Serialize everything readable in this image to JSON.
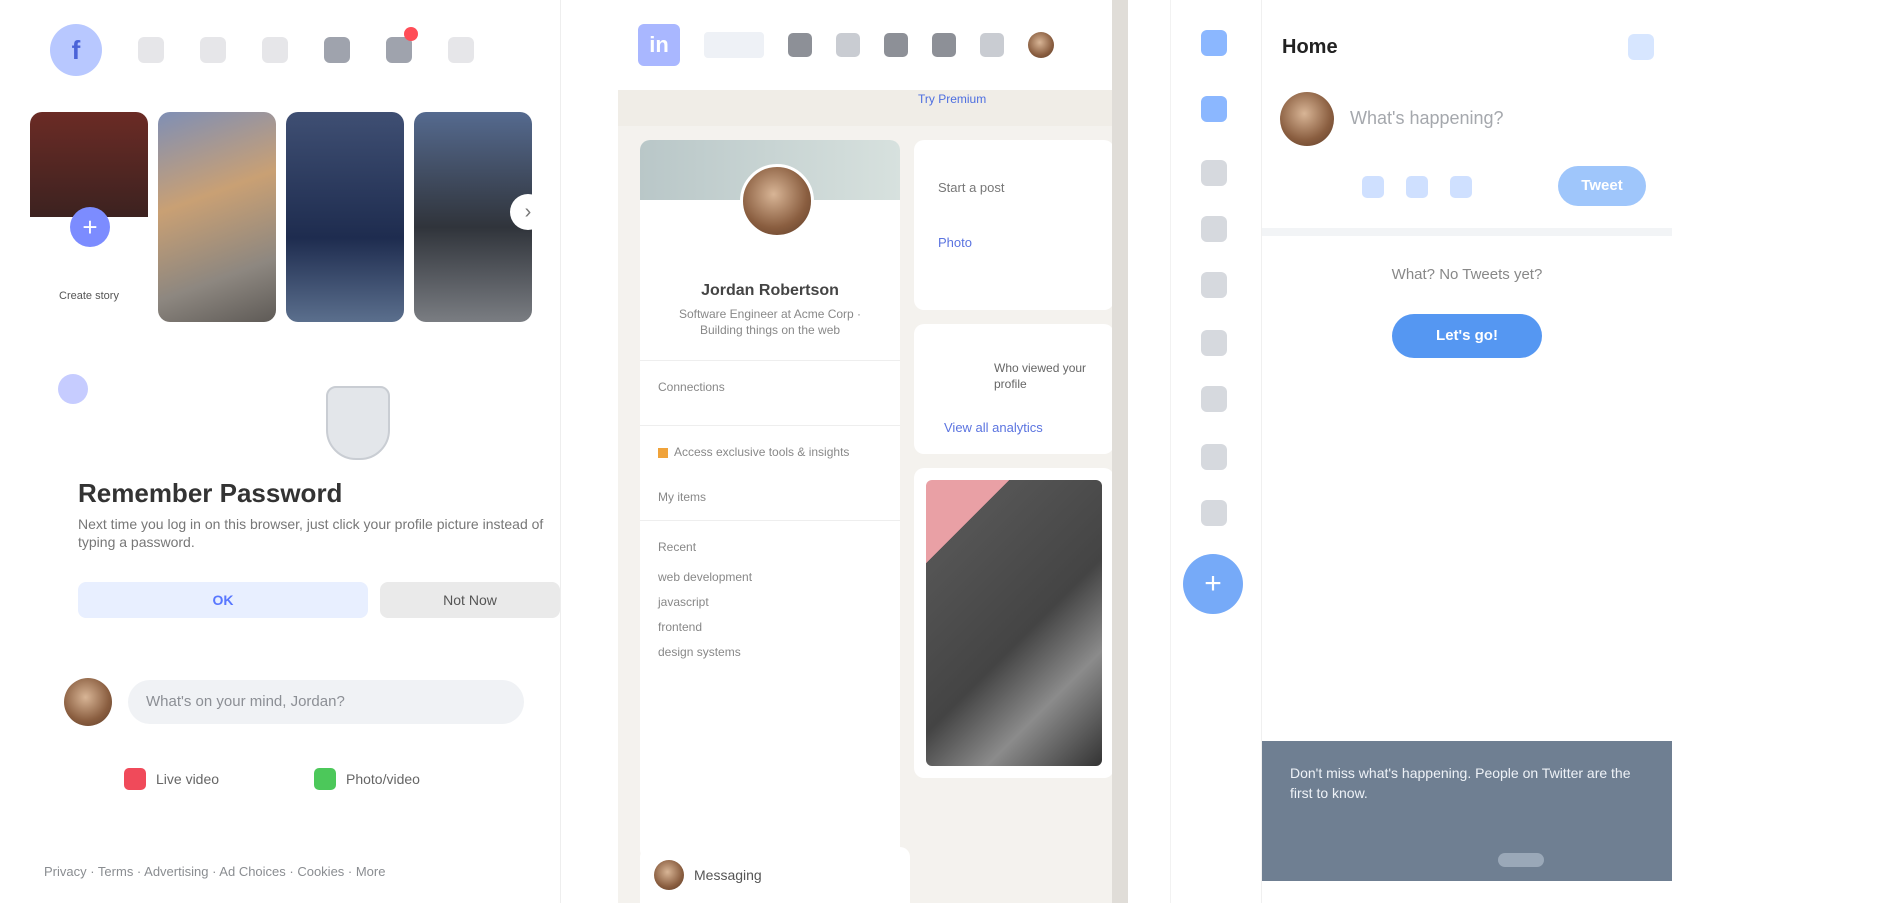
{
  "facebook": {
    "stories": {
      "create_label": "Create story",
      "next_arrow": "›"
    },
    "security_card": {
      "title": "Remember Password",
      "description": "Next time you log in on this browser, just click your profile picture instead of typing a password.",
      "ok_label": "OK",
      "not_now_label": "Not Now"
    },
    "composer": {
      "placeholder": "What's on your mind, Jordan?",
      "live_label": "Live video",
      "photo_label": "Photo/video"
    },
    "footer": "Privacy · Terms · Advertising · Ad Choices · Cookies · More"
  },
  "linkedin": {
    "logo": "in",
    "premium_text": "Try Premium",
    "profile": {
      "name": "Jordan Robertson",
      "headline": "Software Engineer at Acme Corp · Building things on the web",
      "row1": "Connections",
      "row2": "Access exclusive tools & insights",
      "row3": "My items",
      "recent_title": "Recent",
      "recent_items": [
        "web development",
        "javascript",
        "frontend",
        "design systems"
      ]
    },
    "right": {
      "card1_text": "Start a post",
      "card1_link": "Photo",
      "card2_stat": "Who viewed your profile",
      "card2_link": "View all analytics"
    },
    "messaging_label": "Messaging"
  },
  "twitter": {
    "title": "Home",
    "compose_placeholder": "What's happening?",
    "tweet_button": "Tweet",
    "empty_text": "What? No Tweets yet?",
    "cta_button": "Let's go!",
    "compose_fab": "+",
    "banner_text": "Don't miss what's happening. People on Twitter are the first to know."
  }
}
